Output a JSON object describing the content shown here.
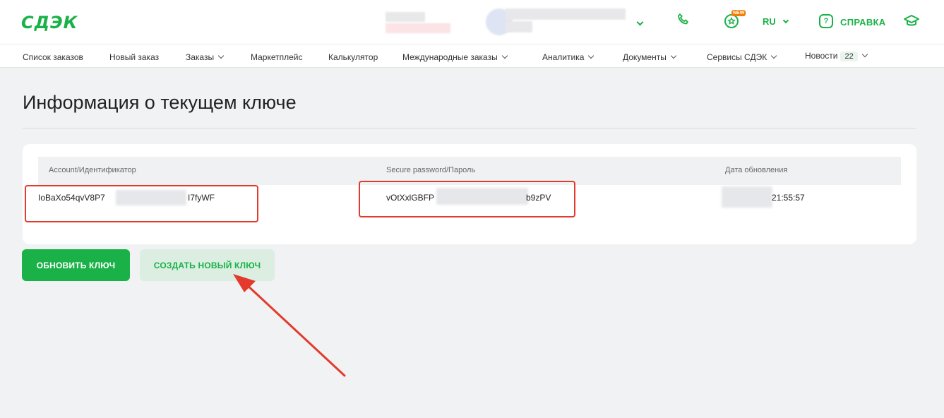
{
  "header": {
    "logo": "СДЭК",
    "new_badge": "NEW",
    "language": "RU",
    "help_label": "СПРАВКА",
    "icons": [
      "chevron-down-icon",
      "phone-icon",
      "chat-icon",
      "help-icon",
      "graduation-cap-icon"
    ]
  },
  "nav": {
    "items": [
      {
        "label": "Список заказов"
      },
      {
        "label": "Новый заказ"
      },
      {
        "label": "Заказы"
      },
      {
        "label": "Маркетплейс"
      },
      {
        "label": "Калькулятор"
      },
      {
        "label": "Международные заказы"
      },
      {
        "label": "Аналитика"
      },
      {
        "label": "Документы"
      },
      {
        "label": "Сервисы СДЭК"
      },
      {
        "label": "Новости",
        "count": "22"
      }
    ]
  },
  "page": {
    "title": "Информация о текущем ключе"
  },
  "key_table": {
    "columns": [
      "Account/Идентификатор",
      "Secure password/Пароль",
      "Дата обновления"
    ],
    "row": {
      "account_start": "IoBaXo54qvV8P7",
      "account_end": "I7fyWF",
      "password_start": "vOtXxlGBFP",
      "password_end": "b9zPV",
      "updated_time": "21:55:57"
    }
  },
  "actions": {
    "refresh_key": "ОБНОВИТЬ КЛЮЧ",
    "create_key": "СОЗДАТЬ НОВЫЙ КЛЮЧ"
  },
  "colors": {
    "brand": "#1ab248",
    "annotation": "#e23b2e"
  }
}
